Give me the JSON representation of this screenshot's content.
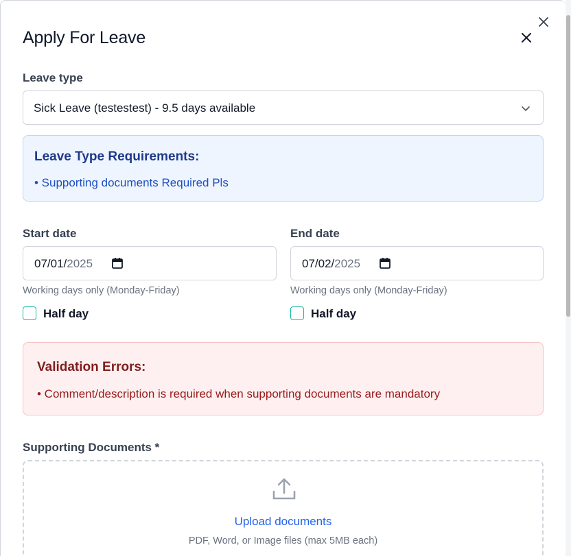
{
  "dialog": {
    "title": "Apply For Leave"
  },
  "leave_type": {
    "label": "Leave type",
    "selected": "Sick Leave (testestest) - 9.5 days available"
  },
  "requirements": {
    "title": "Leave Type Requirements:",
    "items": [
      "• Supporting documents Required Pls"
    ]
  },
  "start_date": {
    "label": "Start date",
    "month_day": "07/01/",
    "year": "2025",
    "hint": "Working days only (Monday-Friday)",
    "half_day_label": "Half day",
    "half_day_checked": false
  },
  "end_date": {
    "label": "End date",
    "month_day": "07/02/",
    "year": "2025",
    "hint": "Working days only (Monday-Friday)",
    "half_day_label": "Half day",
    "half_day_checked": false
  },
  "validation": {
    "title": "Validation Errors:",
    "items": [
      "• Comment/description is required when supporting documents are mandatory"
    ]
  },
  "documents": {
    "label": "Supporting Documents *",
    "upload_link": "Upload documents",
    "upload_hint": "PDF, Word, or Image files (max 5MB each)"
  },
  "icons": {
    "outer_close": "close-icon",
    "inner_close": "close-icon",
    "chevron": "chevron-down-icon",
    "calendar": "calendar-icon",
    "upload": "upload-icon"
  },
  "colors": {
    "info_bg": "#eef5ff",
    "info_text": "#1e3a8a",
    "error_bg": "#fef0f0",
    "error_text": "#991b1b",
    "checkbox_border": "#14b8a6",
    "link": "#2563eb"
  }
}
